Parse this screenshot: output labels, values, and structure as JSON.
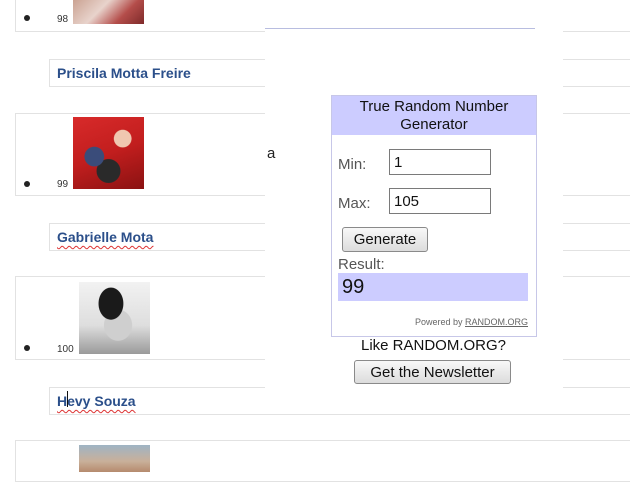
{
  "entries": [
    {
      "rank": "98",
      "name": "Priscila Motta Freire"
    },
    {
      "rank": "99",
      "name": "Gabrielle Mota"
    },
    {
      "rank": "100",
      "name": "Hevy Souza"
    }
  ],
  "stray_char": "a",
  "widget": {
    "title": "True Random Number Generator",
    "min_label": "Min:",
    "min_value": "1",
    "max_label": "Max:",
    "max_value": "105",
    "generate_label": "Generate",
    "result_label": "Result:",
    "result_value": "99",
    "powered_by": "Powered by",
    "powered_link": "RANDOM.ORG"
  },
  "like_text": "Like RANDOM.ORG?",
  "newsletter_label": "Get the Newsletter",
  "colors": {
    "widget_accent": "#ccccff",
    "name_link": "#2b4f8a"
  }
}
